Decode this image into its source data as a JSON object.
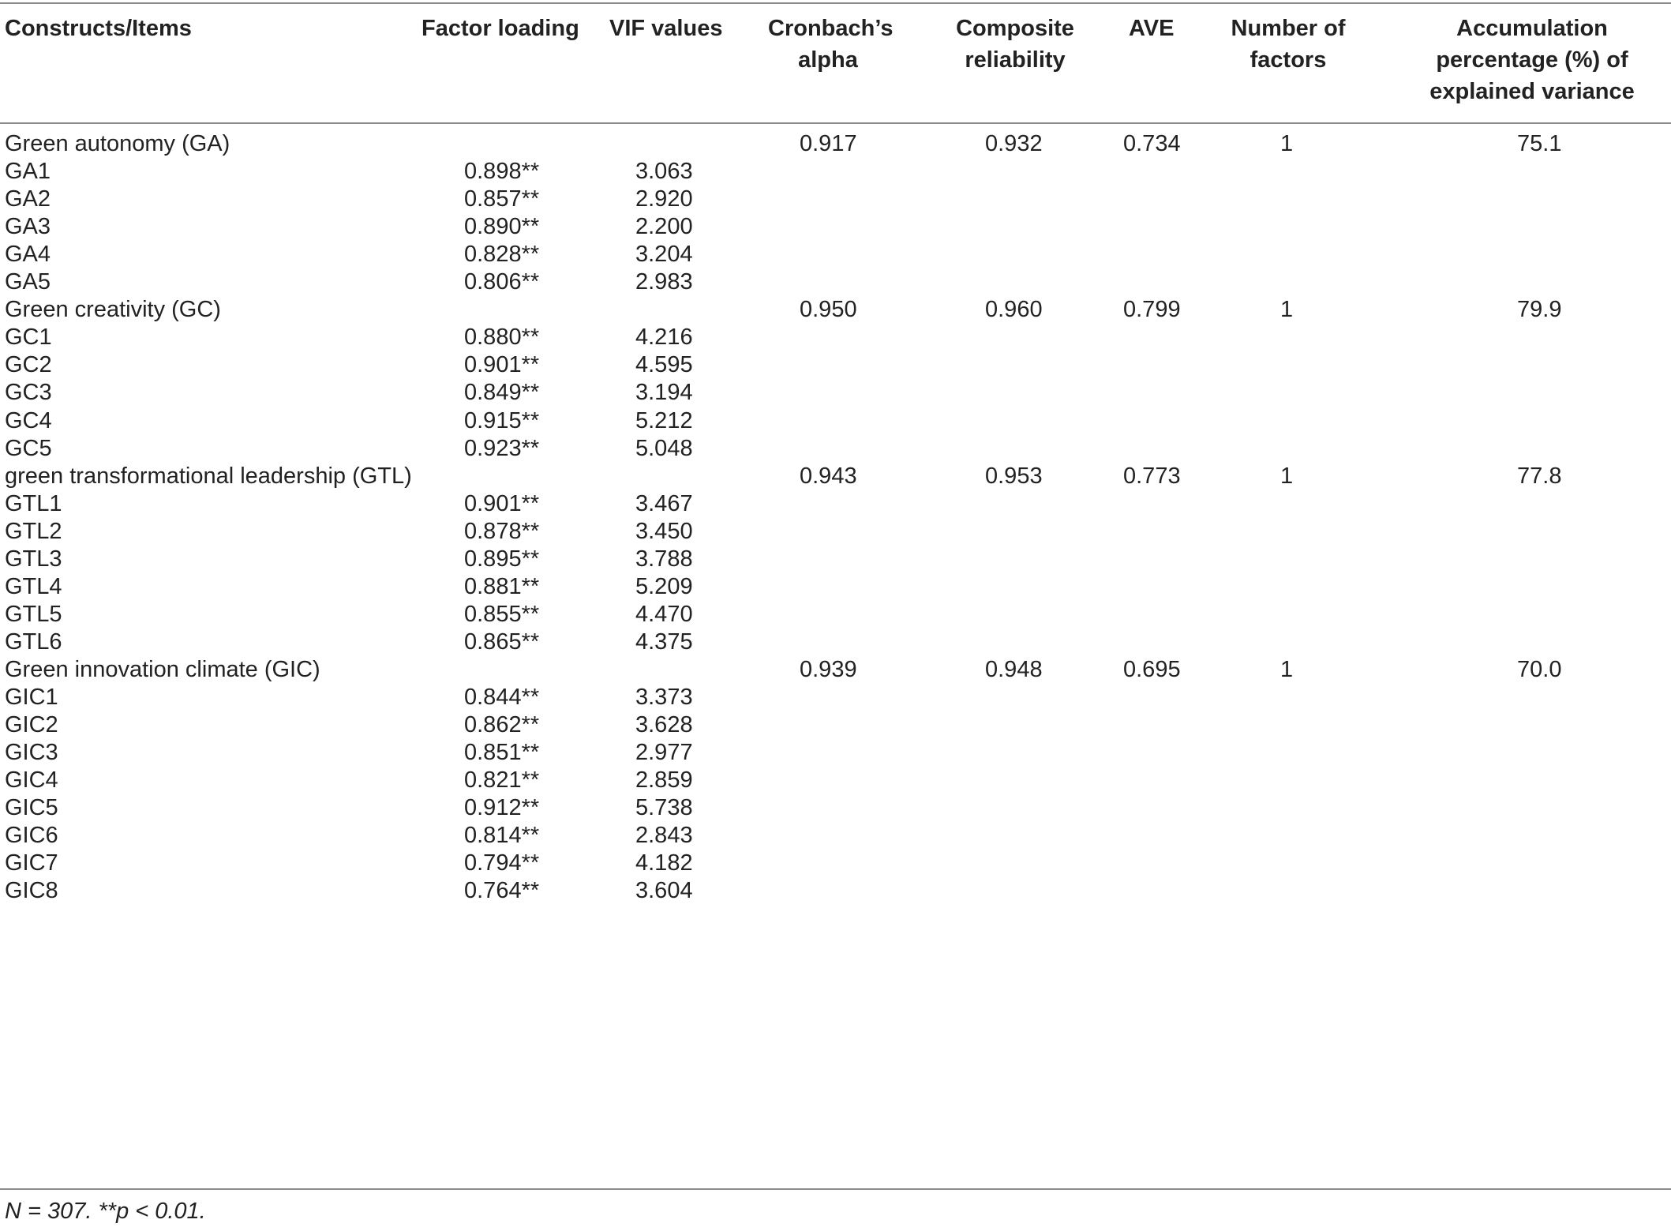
{
  "headers": {
    "item": "Constructs/Items",
    "factor_loading": "Factor loading",
    "vif": "VIF values",
    "alpha_line1": "Cronbach’s",
    "alpha_line2": "alpha",
    "cr_line1": "Composite",
    "cr_line2": "reliability",
    "ave": "AVE",
    "nf_line1": "Number of",
    "nf_line2": "factors",
    "acc_line1": "Accumulation",
    "acc_line2": "percentage (%) of",
    "acc_line3": "explained variance"
  },
  "rows": [
    {
      "item": "Green autonomy (GA)",
      "fl": "",
      "vif": "",
      "alpha": "0.917",
      "cr": "0.932",
      "ave": "0.734",
      "nf": "1",
      "acc": "75.1"
    },
    {
      "item": "GA1",
      "fl": "0.898**",
      "vif": "3.063",
      "alpha": "",
      "cr": "",
      "ave": "",
      "nf": "",
      "acc": ""
    },
    {
      "item": "GA2",
      "fl": "0.857**",
      "vif": "2.920",
      "alpha": "",
      "cr": "",
      "ave": "",
      "nf": "",
      "acc": ""
    },
    {
      "item": "GA3",
      "fl": "0.890**",
      "vif": "2.200",
      "alpha": "",
      "cr": "",
      "ave": "",
      "nf": "",
      "acc": ""
    },
    {
      "item": "GA4",
      "fl": "0.828**",
      "vif": "3.204",
      "alpha": "",
      "cr": "",
      "ave": "",
      "nf": "",
      "acc": ""
    },
    {
      "item": "GA5",
      "fl": "0.806**",
      "vif": "2.983",
      "alpha": "",
      "cr": "",
      "ave": "",
      "nf": "",
      "acc": ""
    },
    {
      "item": "Green creativity (GC)",
      "fl": "",
      "vif": "",
      "alpha": "0.950",
      "cr": "0.960",
      "ave": "0.799",
      "nf": "1",
      "acc": "79.9"
    },
    {
      "item": "GC1",
      "fl": "0.880**",
      "vif": "4.216",
      "alpha": "",
      "cr": "",
      "ave": "",
      "nf": "",
      "acc": ""
    },
    {
      "item": "GC2",
      "fl": "0.901**",
      "vif": "4.595",
      "alpha": "",
      "cr": "",
      "ave": "",
      "nf": "",
      "acc": ""
    },
    {
      "item": "GC3",
      "fl": "0.849**",
      "vif": "3.194",
      "alpha": "",
      "cr": "",
      "ave": "",
      "nf": "",
      "acc": ""
    },
    {
      "item": "GC4",
      "fl": "0.915**",
      "vif": "5.212",
      "alpha": "",
      "cr": "",
      "ave": "",
      "nf": "",
      "acc": ""
    },
    {
      "item": "GC5",
      "fl": "0.923**",
      "vif": "5.048",
      "alpha": "",
      "cr": "",
      "ave": "",
      "nf": "",
      "acc": ""
    },
    {
      "item": "green transformational leadership (GTL)",
      "fl": "",
      "vif": "",
      "alpha": "0.943",
      "cr": "0.953",
      "ave": "0.773",
      "nf": "1",
      "acc": "77.8"
    },
    {
      "item": "GTL1",
      "fl": "0.901**",
      "vif": "3.467",
      "alpha": "",
      "cr": "",
      "ave": "",
      "nf": "",
      "acc": ""
    },
    {
      "item": "GTL2",
      "fl": "0.878**",
      "vif": "3.450",
      "alpha": "",
      "cr": "",
      "ave": "",
      "nf": "",
      "acc": ""
    },
    {
      "item": "GTL3",
      "fl": "0.895**",
      "vif": "3.788",
      "alpha": "",
      "cr": "",
      "ave": "",
      "nf": "",
      "acc": ""
    },
    {
      "item": "GTL4",
      "fl": "0.881**",
      "vif": "5.209",
      "alpha": "",
      "cr": "",
      "ave": "",
      "nf": "",
      "acc": ""
    },
    {
      "item": "GTL5",
      "fl": "0.855**",
      "vif": "4.470",
      "alpha": "",
      "cr": "",
      "ave": "",
      "nf": "",
      "acc": ""
    },
    {
      "item": "GTL6",
      "fl": "0.865**",
      "vif": "4.375",
      "alpha": "",
      "cr": "",
      "ave": "",
      "nf": "",
      "acc": ""
    },
    {
      "item": "Green innovation climate (GIC)",
      "fl": "",
      "vif": "",
      "alpha": "0.939",
      "cr": "0.948",
      "ave": "0.695",
      "nf": "1",
      "acc": "70.0"
    },
    {
      "item": "GIC1",
      "fl": "0.844**",
      "vif": "3.373",
      "alpha": "",
      "cr": "",
      "ave": "",
      "nf": "",
      "acc": ""
    },
    {
      "item": "GIC2",
      "fl": "0.862**",
      "vif": "3.628",
      "alpha": "",
      "cr": "",
      "ave": "",
      "nf": "",
      "acc": ""
    },
    {
      "item": "GIC3",
      "fl": "0.851**",
      "vif": "2.977",
      "alpha": "",
      "cr": "",
      "ave": "",
      "nf": "",
      "acc": ""
    },
    {
      "item": "GIC4",
      "fl": "0.821**",
      "vif": "2.859",
      "alpha": "",
      "cr": "",
      "ave": "",
      "nf": "",
      "acc": ""
    },
    {
      "item": "GIC5",
      "fl": "0.912**",
      "vif": "5.738",
      "alpha": "",
      "cr": "",
      "ave": "",
      "nf": "",
      "acc": ""
    },
    {
      "item": "GIC6",
      "fl": "0.814**",
      "vif": "2.843",
      "alpha": "",
      "cr": "",
      "ave": "",
      "nf": "",
      "acc": ""
    },
    {
      "item": "GIC7",
      "fl": "0.794**",
      "vif": "4.182",
      "alpha": "",
      "cr": "",
      "ave": "",
      "nf": "",
      "acc": ""
    },
    {
      "item": "GIC8",
      "fl": "0.764**",
      "vif": "3.604",
      "alpha": "",
      "cr": "",
      "ave": "",
      "nf": "",
      "acc": ""
    }
  ],
  "note": "N = 307. **p < 0.01."
}
